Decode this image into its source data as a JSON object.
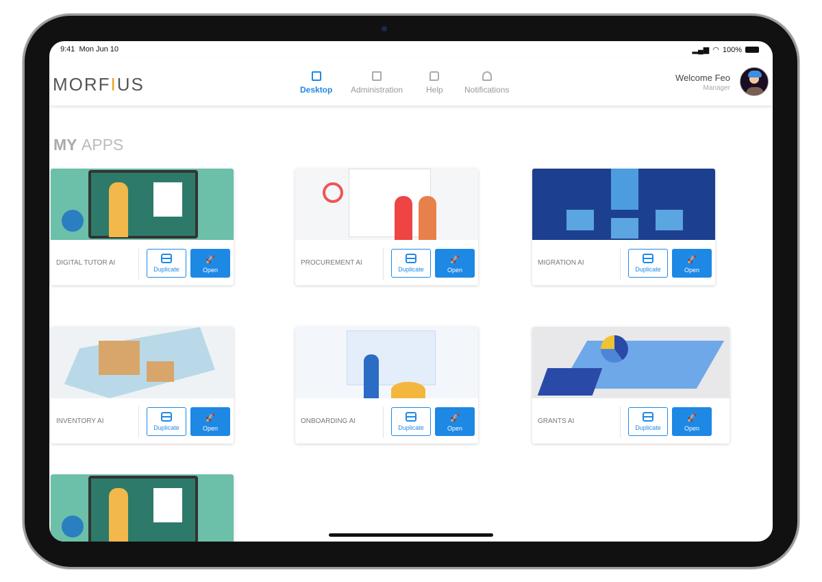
{
  "status_bar": {
    "time": "9:41",
    "date": "Mon Jun 10",
    "battery": "100%"
  },
  "header": {
    "logo": "MORFIUS",
    "nav": [
      {
        "label": "Desktop",
        "icon": "grid-icon",
        "active": true
      },
      {
        "label": "Administration",
        "icon": "board-icon"
      },
      {
        "label": "Help",
        "icon": "chat-bubble-icon"
      },
      {
        "label": "Notifications",
        "icon": "bell-icon"
      }
    ],
    "user": {
      "welcome": "Welcome Feo",
      "role": "Manager"
    }
  },
  "page": {
    "title_bold": "MY",
    "title_rest": "APPS"
  },
  "buttons": {
    "duplicate": "Duplicate",
    "open": "Open"
  },
  "apps": [
    {
      "name": "DIGITAL TUTOR AI",
      "bg": "#6cbfa8"
    },
    {
      "name": "PROCUREMENT AI",
      "bg": "#f4f6f8"
    },
    {
      "name": "MIGRATION AI",
      "bg": "#1d3f8f"
    },
    {
      "name": "INVENTORY AI",
      "bg": "#eef2f5"
    },
    {
      "name": "ONBOARDING AI",
      "bg": "#f3f6fb"
    },
    {
      "name": "GRANTS AI",
      "bg": "#e8e8ea"
    },
    {
      "name": "",
      "bg": "#6cbfa8"
    }
  ],
  "colors": {
    "accent": "#1e88e5"
  }
}
